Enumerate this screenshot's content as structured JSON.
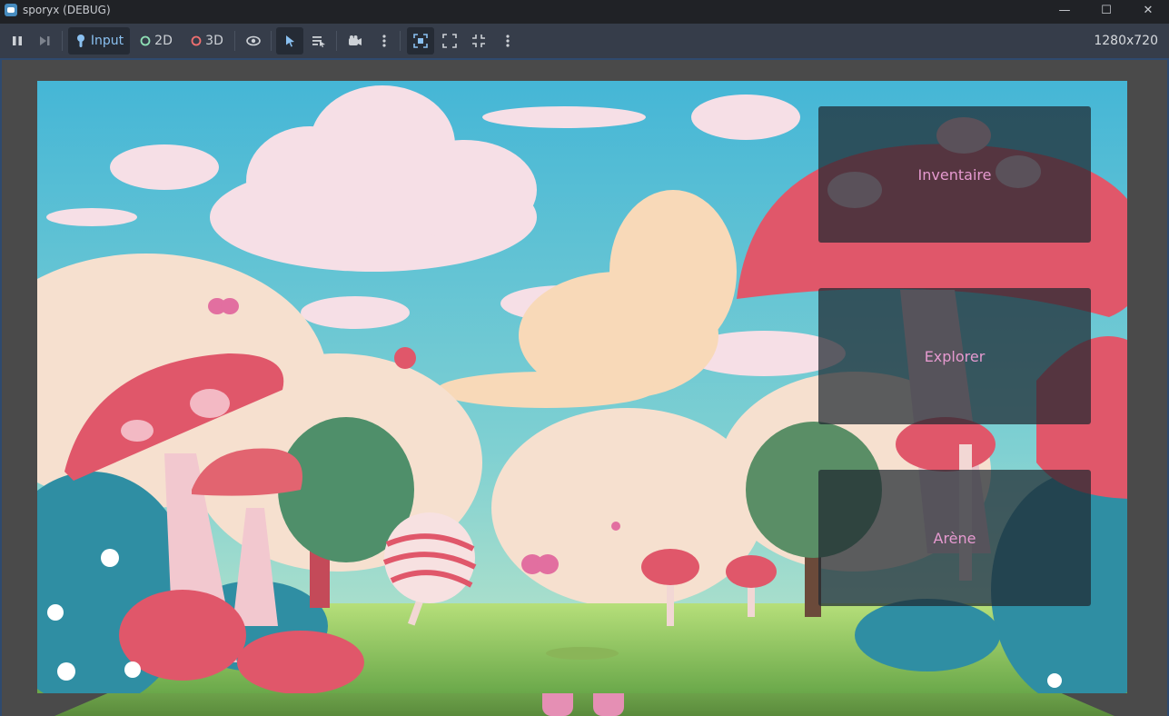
{
  "window": {
    "title": "sporyx (DEBUG)",
    "controls": {
      "minimize": "—",
      "maximize": "☐",
      "close": "✕"
    }
  },
  "toolbar": {
    "modes": [
      {
        "label": "Input",
        "active": true
      },
      {
        "label": "2D",
        "active": false
      },
      {
        "label": "3D",
        "active": false
      }
    ],
    "resolution": "1280x720"
  },
  "colors": {
    "toolbar_bg": "#363d4a",
    "accent": "#478cbf",
    "menu_text": "#e69ad0",
    "mode_2d": "#8fe0b5",
    "mode_3d": "#f07070"
  },
  "game_menu": {
    "buttons": [
      "Inventaire",
      "Explorer",
      "Arène"
    ]
  }
}
